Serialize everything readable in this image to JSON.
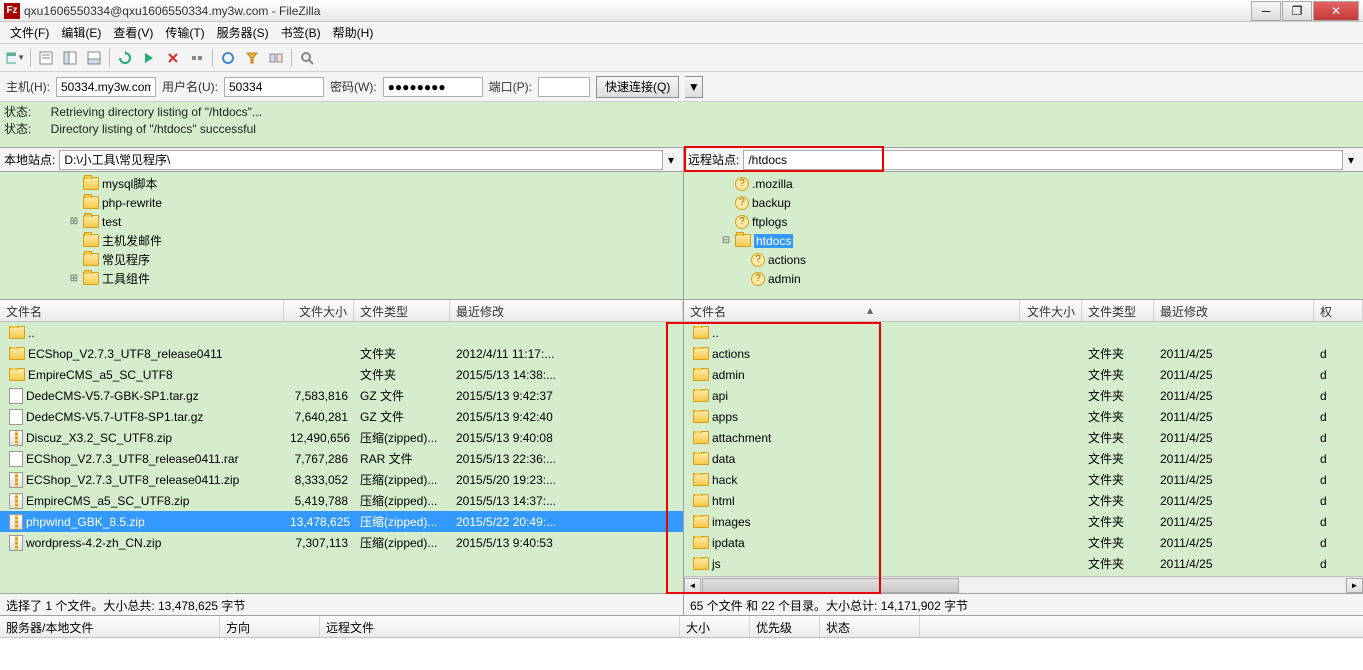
{
  "title": "qxu1606550334@qxu1606550334.my3w.com - FileZilla",
  "menu": [
    "文件(F)",
    "编辑(E)",
    "查看(V)",
    "传输(T)",
    "服务器(S)",
    "书签(B)",
    "帮助(H)"
  ],
  "connect": {
    "host_label": "主机(H):",
    "host": "50334.my3w.com",
    "user_label": "用户名(U):",
    "user": "50334",
    "pass_label": "密码(W):",
    "pass": "●●●●●●●●",
    "port_label": "端口(P):",
    "port": "",
    "quick": "快速连接(Q)"
  },
  "log": [
    {
      "label": "状态:",
      "msg": "Retrieving directory listing of \"/htdocs\"..."
    },
    {
      "label": "状态:",
      "msg": "Directory listing of \"/htdocs\" successful"
    }
  ],
  "local": {
    "site_label": "本地站点:",
    "path": "D:\\小工具\\常见程序\\",
    "tree": [
      {
        "indent": 4,
        "toggle": "",
        "icon": "folder",
        "label": "mysql脚本"
      },
      {
        "indent": 4,
        "toggle": "",
        "icon": "folder",
        "label": "php-rewrite"
      },
      {
        "indent": 4,
        "toggle": "+",
        "icon": "folder",
        "label": "test"
      },
      {
        "indent": 4,
        "toggle": "",
        "icon": "folder",
        "label": "主机发邮件"
      },
      {
        "indent": 4,
        "toggle": "",
        "icon": "folder",
        "label": "常见程序"
      },
      {
        "indent": 4,
        "toggle": "+",
        "icon": "folder",
        "label": "工具组件"
      }
    ],
    "cols": {
      "name": "文件名",
      "size": "文件大小",
      "type": "文件类型",
      "mtime": "最近修改"
    },
    "rows": [
      {
        "icon": "folder",
        "name": "..",
        "size": "",
        "type": "",
        "mtime": ""
      },
      {
        "icon": "folder",
        "name": "ECShop_V2.7.3_UTF8_release0411",
        "size": "",
        "type": "文件夹",
        "mtime": "2012/4/11 11:17:..."
      },
      {
        "icon": "folder",
        "name": "EmpireCMS_a5_SC_UTF8",
        "size": "",
        "type": "文件夹",
        "mtime": "2015/5/13 14:38:..."
      },
      {
        "icon": "file",
        "name": "DedeCMS-V5.7-GBK-SP1.tar.gz",
        "size": "7,583,816",
        "type": "GZ 文件",
        "mtime": "2015/5/13 9:42:37"
      },
      {
        "icon": "file",
        "name": "DedeCMS-V5.7-UTF8-SP1.tar.gz",
        "size": "7,640,281",
        "type": "GZ 文件",
        "mtime": "2015/5/13 9:42:40"
      },
      {
        "icon": "zip",
        "name": "Discuz_X3.2_SC_UTF8.zip",
        "size": "12,490,656",
        "type": "压缩(zipped)...",
        "mtime": "2015/5/13 9:40:08"
      },
      {
        "icon": "file",
        "name": "ECShop_V2.7.3_UTF8_release0411.rar",
        "size": "7,767,286",
        "type": "RAR 文件",
        "mtime": "2015/5/13 22:36:..."
      },
      {
        "icon": "zip",
        "name": "ECShop_V2.7.3_UTF8_release0411.zip",
        "size": "8,333,052",
        "type": "压缩(zipped)...",
        "mtime": "2015/5/20 19:23:..."
      },
      {
        "icon": "zip",
        "name": "EmpireCMS_a5_SC_UTF8.zip",
        "size": "5,419,788",
        "type": "压缩(zipped)...",
        "mtime": "2015/5/13 14:37:..."
      },
      {
        "icon": "zip",
        "name": "phpwind_GBK_8.5.zip",
        "size": "13,478,625",
        "type": "压缩(zipped)...",
        "mtime": "2015/5/22 20:49:...",
        "sel": true
      },
      {
        "icon": "zip",
        "name": "wordpress-4.2-zh_CN.zip",
        "size": "7,307,113",
        "type": "压缩(zipped)...",
        "mtime": "2015/5/13 9:40:53"
      }
    ],
    "status": "选择了 1 个文件。大小总共: 13,478,625 字节"
  },
  "remote": {
    "site_label": "远程站点:",
    "path": "/htdocs",
    "tree": [
      {
        "indent": 2,
        "toggle": "",
        "icon": "q",
        "label": ".mozilla"
      },
      {
        "indent": 2,
        "toggle": "",
        "icon": "q",
        "label": "backup"
      },
      {
        "indent": 2,
        "toggle": "",
        "icon": "q",
        "label": "ftplogs"
      },
      {
        "indent": 2,
        "toggle": "-",
        "icon": "folder",
        "label": "htdocs",
        "sel": true
      },
      {
        "indent": 3,
        "toggle": "",
        "icon": "q",
        "label": "actions"
      },
      {
        "indent": 3,
        "toggle": "",
        "icon": "q",
        "label": "admin"
      }
    ],
    "cols": {
      "name": "文件名",
      "size": "文件大小",
      "type": "文件类型",
      "mtime": "最近修改",
      "perm": "权"
    },
    "rows": [
      {
        "icon": "folder",
        "name": "..",
        "size": "",
        "type": "",
        "mtime": "",
        "perm": ""
      },
      {
        "icon": "folder",
        "name": "actions",
        "size": "",
        "type": "文件夹",
        "mtime": "2011/4/25",
        "perm": "d"
      },
      {
        "icon": "folder",
        "name": "admin",
        "size": "",
        "type": "文件夹",
        "mtime": "2011/4/25",
        "perm": "d"
      },
      {
        "icon": "folder",
        "name": "api",
        "size": "",
        "type": "文件夹",
        "mtime": "2011/4/25",
        "perm": "d"
      },
      {
        "icon": "folder",
        "name": "apps",
        "size": "",
        "type": "文件夹",
        "mtime": "2011/4/25",
        "perm": "d"
      },
      {
        "icon": "folder",
        "name": "attachment",
        "size": "",
        "type": "文件夹",
        "mtime": "2011/4/25",
        "perm": "d"
      },
      {
        "icon": "folder",
        "name": "data",
        "size": "",
        "type": "文件夹",
        "mtime": "2011/4/25",
        "perm": "d"
      },
      {
        "icon": "folder",
        "name": "hack",
        "size": "",
        "type": "文件夹",
        "mtime": "2011/4/25",
        "perm": "d"
      },
      {
        "icon": "folder",
        "name": "html",
        "size": "",
        "type": "文件夹",
        "mtime": "2011/4/25",
        "perm": "d"
      },
      {
        "icon": "folder",
        "name": "images",
        "size": "",
        "type": "文件夹",
        "mtime": "2011/4/25",
        "perm": "d"
      },
      {
        "icon": "folder",
        "name": "ipdata",
        "size": "",
        "type": "文件夹",
        "mtime": "2011/4/25",
        "perm": "d"
      },
      {
        "icon": "folder",
        "name": "js",
        "size": "",
        "type": "文件夹",
        "mtime": "2011/4/25",
        "perm": "d"
      }
    ],
    "status": "65 个文件 和 22 个目录。大小总计: 14,171,902 字节"
  },
  "queue_cols": [
    "服务器/本地文件",
    "方向",
    "远程文件",
    "大小",
    "优先级",
    "状态"
  ]
}
